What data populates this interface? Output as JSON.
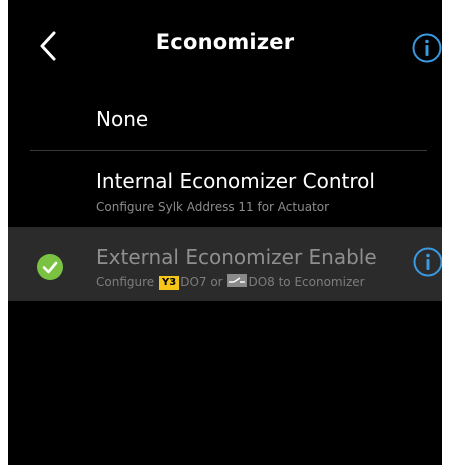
{
  "header": {
    "title": "Economizer",
    "back_icon": "chevron-left-icon",
    "info_icon": "info-icon"
  },
  "options": [
    {
      "label": "None",
      "subtitle": "",
      "selected": false
    },
    {
      "label": "Internal Economizer Control",
      "subtitle": "Configure Sylk Address 11 for Actuator",
      "selected": false
    },
    {
      "label": "External Economizer Enable",
      "subtitle_parts": {
        "prefix": "Configure",
        "tag1": "Y3",
        "middle": "DO7 or",
        "tag2_icon": "relay-contact-icon",
        "suffix": "DO8 to Economizer"
      },
      "selected": true,
      "status_icon": "check-circle-icon",
      "info_icon": "info-icon"
    }
  ],
  "colors": {
    "background": "#000000",
    "selected_row": "#2b2b2b",
    "accent_info": "#3a9ae0",
    "check_green": "#7cc242",
    "tag_yellow": "#f5c518"
  }
}
